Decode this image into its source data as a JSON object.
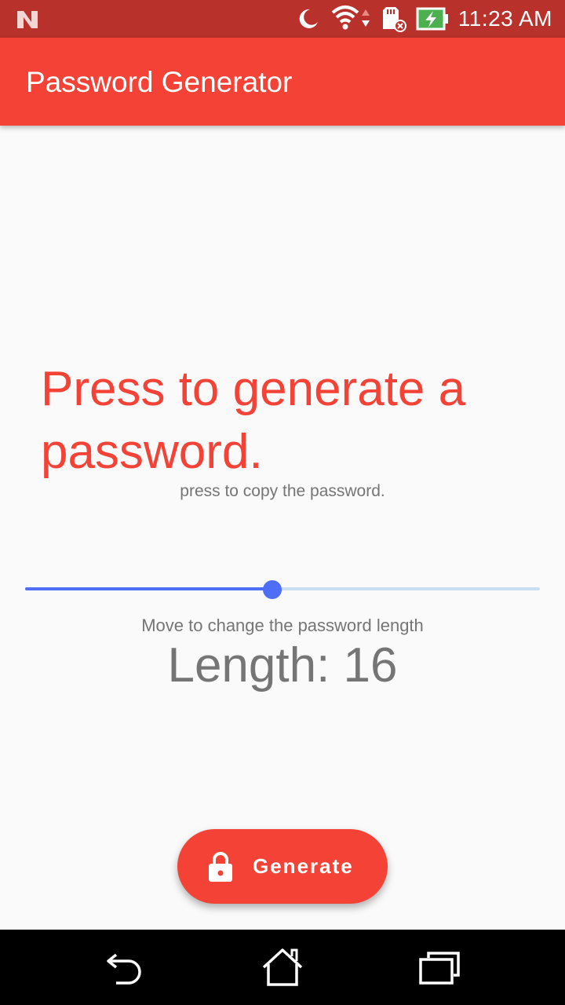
{
  "status_bar": {
    "time": "11:23 AM",
    "icons": [
      "n-logo-icon",
      "moon-icon",
      "wifi-icon",
      "sd-card-icon",
      "battery-charging-icon"
    ]
  },
  "app_bar": {
    "title": "Password Generator"
  },
  "main": {
    "password_text": "Press to generate a password.",
    "copy_hint": "press to copy the password.",
    "slider": {
      "value": 16,
      "fraction": 0.48
    },
    "slider_hint": "Move to change the password length",
    "length_label": "Length: 16"
  },
  "generate_button": {
    "label": "Generate",
    "icon": "lock-icon"
  },
  "nav_bar": {
    "icons": [
      "back-icon",
      "home-icon",
      "recents-icon"
    ]
  },
  "colors": {
    "primary": "#f44336",
    "status_bar": "#b8322b",
    "accent": "#4d6ef5",
    "text_secondary": "#757575"
  }
}
